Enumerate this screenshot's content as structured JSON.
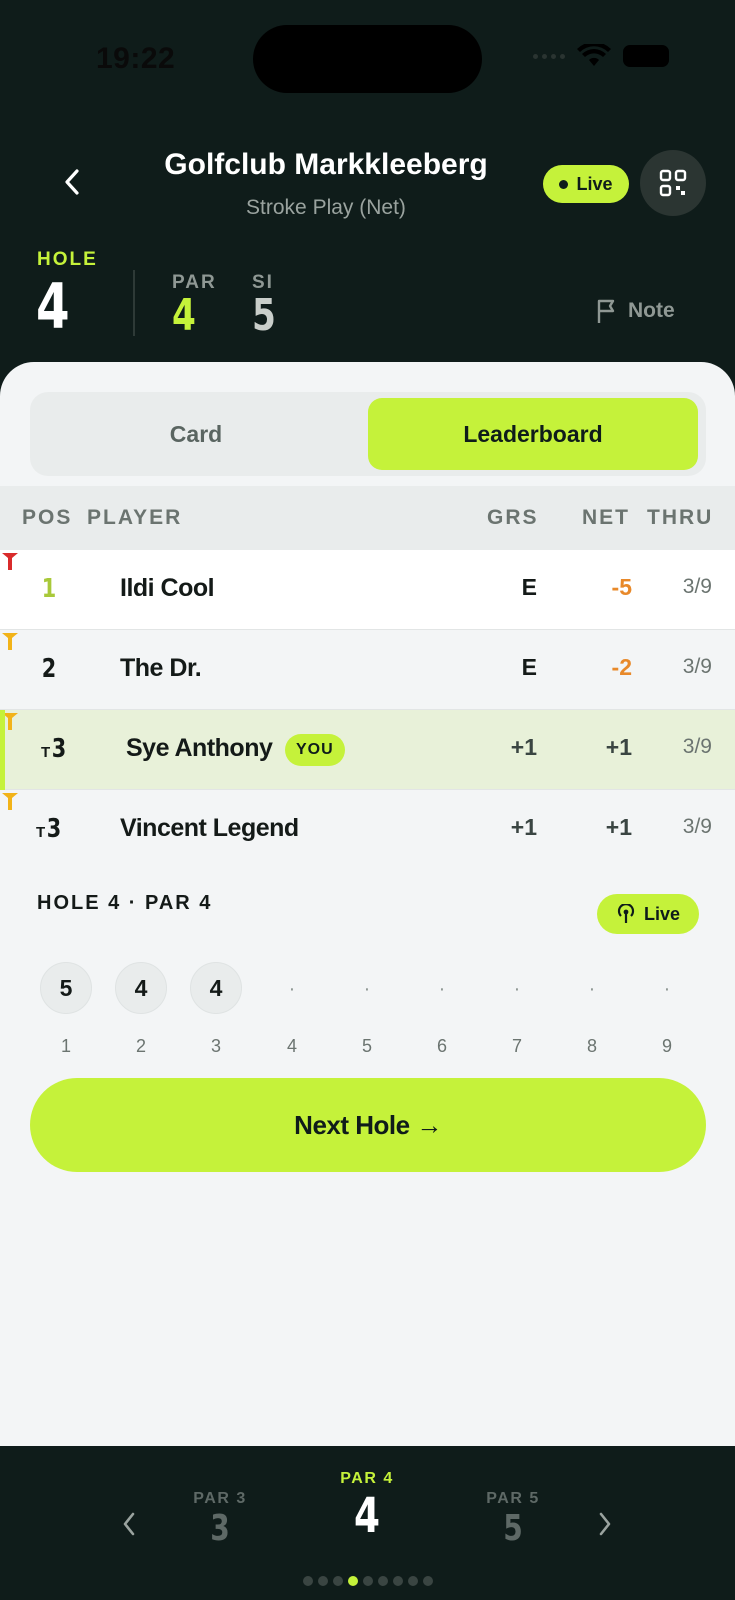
{
  "status": {
    "time": "19:22"
  },
  "header": {
    "title": "Golfclub Markkleeberg",
    "subtitle": "Stroke Play (Net)",
    "live_label": "Live"
  },
  "hole_info": {
    "hole_label": "HOLE",
    "hole_number": "4",
    "par_label": "PAR",
    "par_value": "4",
    "si_label": "SI",
    "si_value": "5",
    "note_label": "Note"
  },
  "tabs": {
    "card": "Card",
    "leaderboard": "Leaderboard",
    "active": "leaderboard"
  },
  "table": {
    "headers": {
      "pos": "POS",
      "player": "PLAYER",
      "grs": "GRS",
      "net": "NET",
      "thru": "THRU"
    },
    "rows": [
      {
        "pos": "1",
        "tie": "",
        "name": "Ildi Cool",
        "grs": "E",
        "net": "-5",
        "thru": "3/9",
        "tee_color": "#d92b2b",
        "you": false
      },
      {
        "pos": "2",
        "tie": "",
        "name": "The Dr.",
        "grs": "E",
        "net": "-2",
        "thru": "3/9",
        "tee_color": "#f2b318",
        "you": false
      },
      {
        "pos": "3",
        "tie": "T",
        "name": "Sye Anthony",
        "grs": "+1",
        "net": "+1",
        "thru": "3/9",
        "tee_color": "#f2b318",
        "you": true,
        "you_label": "YOU"
      },
      {
        "pos": "3",
        "tie": "T",
        "name": "Vincent Legend",
        "grs": "+1",
        "net": "+1",
        "thru": "3/9",
        "tee_color": "#f2b318",
        "you": false
      }
    ]
  },
  "hole_strip": {
    "title": "HOLE 4 · PAR 4",
    "live_label": "Live",
    "scores": [
      "5",
      "4",
      "4",
      "·",
      "·",
      "·",
      "·",
      "·",
      "·"
    ],
    "holes": [
      "1",
      "2",
      "3",
      "4",
      "5",
      "6",
      "7",
      "8",
      "9"
    ]
  },
  "next_button": "Next Hole →",
  "bottom_nav": {
    "prev": {
      "par": "PAR 3",
      "hole": "3"
    },
    "current": {
      "par": "PAR 4",
      "hole": "4"
    },
    "next": {
      "par": "PAR 5",
      "hole": "5"
    },
    "page_count": 9,
    "active_page": 4
  },
  "colors": {
    "accent": "#c5f23a",
    "dark": "#0f1c1a",
    "net_negative": "#e8892a"
  }
}
